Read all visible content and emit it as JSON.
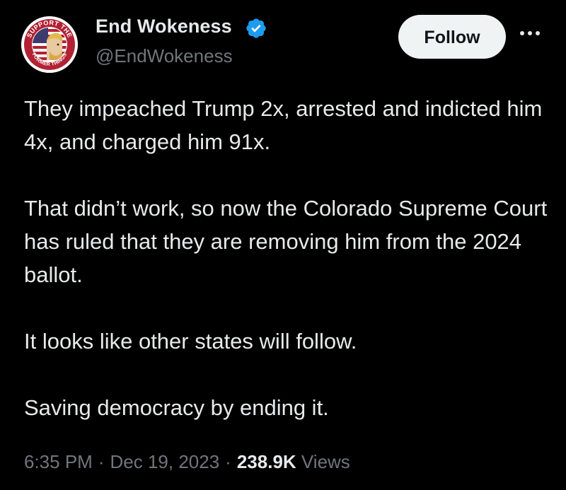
{
  "author": {
    "display_name": "End Wokeness",
    "handle": "@EndWokeness",
    "verified": true,
    "avatar_icon": "support-former-things-badge-icon",
    "avatar_text_top": "SUPPORT THE",
    "avatar_text_bottom": "FORMER THINGS"
  },
  "actions": {
    "follow_label": "Follow",
    "more_icon": "more-horizontal-icon"
  },
  "tweet": {
    "paragraphs": [
      "They impeached Trump 2x, arrested and indicted him 4x, and charged him 91x.",
      "That didn’t work, so now the Colorado Supreme Court has ruled that they are removing him from the 2024 ballot.",
      "It looks like other states will follow.",
      "Saving democracy by ending it."
    ]
  },
  "meta": {
    "time": "6:35 PM",
    "separator": "·",
    "date": "Dec 19, 2023",
    "views_count": "238.9K",
    "views_label": "Views"
  },
  "colors": {
    "background": "#000000",
    "text_primary": "#e7e9ea",
    "text_secondary": "#71767b",
    "verified_blue": "#1d9bf0",
    "follow_bg": "#eff3f4"
  }
}
